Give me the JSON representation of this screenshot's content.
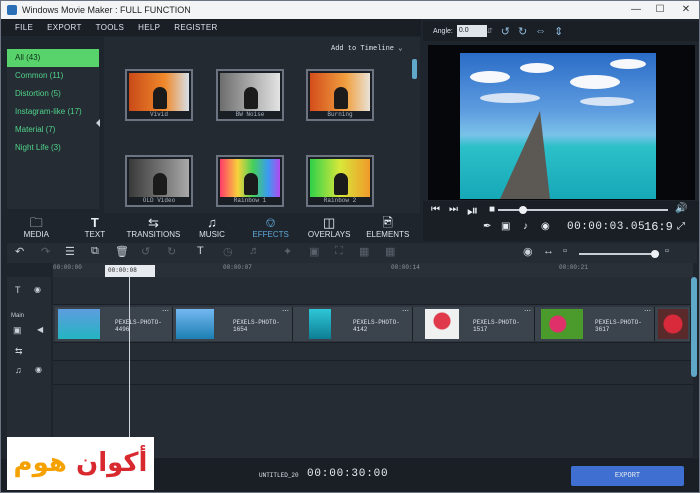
{
  "window": {
    "title": "Windows Movie Maker : FULL FUNCTION"
  },
  "menu": [
    "FILE",
    "EXPORT",
    "TOOLS",
    "HELP",
    "REGISTER"
  ],
  "categories": [
    {
      "label": "All (43)",
      "selected": true
    },
    {
      "label": "Common (11)"
    },
    {
      "label": "Distortion (5)"
    },
    {
      "label": "Instagram-like (17)"
    },
    {
      "label": "Material (7)"
    },
    {
      "label": "Night Life (3)"
    }
  ],
  "add_to_timeline": "Add to Timeline",
  "effects": [
    {
      "name": "Vivid"
    },
    {
      "name": "BW Noise"
    },
    {
      "name": "Burning"
    },
    {
      "name": "OLD Video"
    },
    {
      "name": "Rainbow 1"
    },
    {
      "name": "Rainbow 2"
    }
  ],
  "tabs": [
    {
      "label": "MEDIA",
      "icon": "folder-icon"
    },
    {
      "label": "TEXT",
      "icon": "text-icon"
    },
    {
      "label": "TRANSITIONS",
      "icon": "transitions-icon"
    },
    {
      "label": "MUSIC",
      "icon": "music-icon"
    },
    {
      "label": "EFFECTS",
      "icon": "effects-icon",
      "selected": true
    },
    {
      "label": "OVERLAYS",
      "icon": "overlays-icon"
    },
    {
      "label": "ELEMENTS",
      "icon": "elements-icon"
    }
  ],
  "preview": {
    "angle_label": "Angle:",
    "angle_value": "0.0",
    "time": "00:00:03.05",
    "aspect": "16:9"
  },
  "ruler": {
    "playhead": "00:00:08",
    "ticks": [
      "00:00:00",
      "00:00:07",
      "00:00:14",
      "00:00:21"
    ]
  },
  "tracks": {
    "main_label": "Main"
  },
  "clips": [
    {
      "label": "PEXELS-PHOTO-4496"
    },
    {
      "label": "PEXELS-PHOTO-1654"
    },
    {
      "label": "PEXELS-PHOTO-4142"
    },
    {
      "label": "PEXELS-PHOTO-1517"
    },
    {
      "label": "PEXELS-PHOTO-3617"
    }
  ],
  "status": {
    "project": "UNTITLED_20",
    "duration": "00:00:30:00",
    "export_label": "EXPORT"
  },
  "logo": {
    "text_a": "أكوان",
    "text_b": "هوم"
  }
}
